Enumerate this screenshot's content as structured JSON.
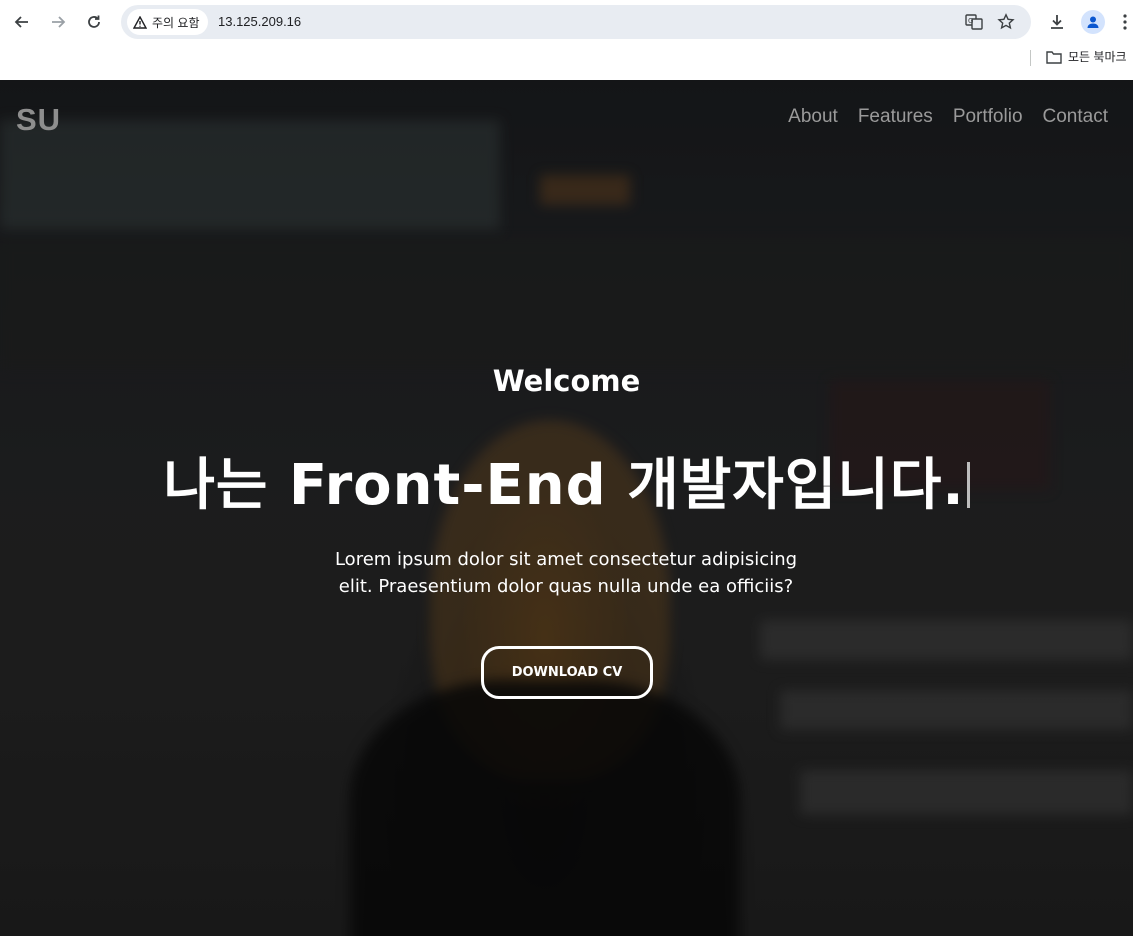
{
  "browser": {
    "security_label": "주의 요함",
    "url": "13.125.209.16",
    "bookmarks_folder": "모든 북마크"
  },
  "site": {
    "logo": "SU",
    "nav": [
      "About",
      "Features",
      "Portfolio",
      "Contact"
    ]
  },
  "hero": {
    "welcome": "Welcome",
    "headline": "나는 Front-End 개발자입니다.",
    "description": "Lorem ipsum dolor sit amet consectetur adipisicing elit. Praesentium dolor quas nulla unde ea officiis?",
    "button": "DOWNLOAD CV"
  }
}
